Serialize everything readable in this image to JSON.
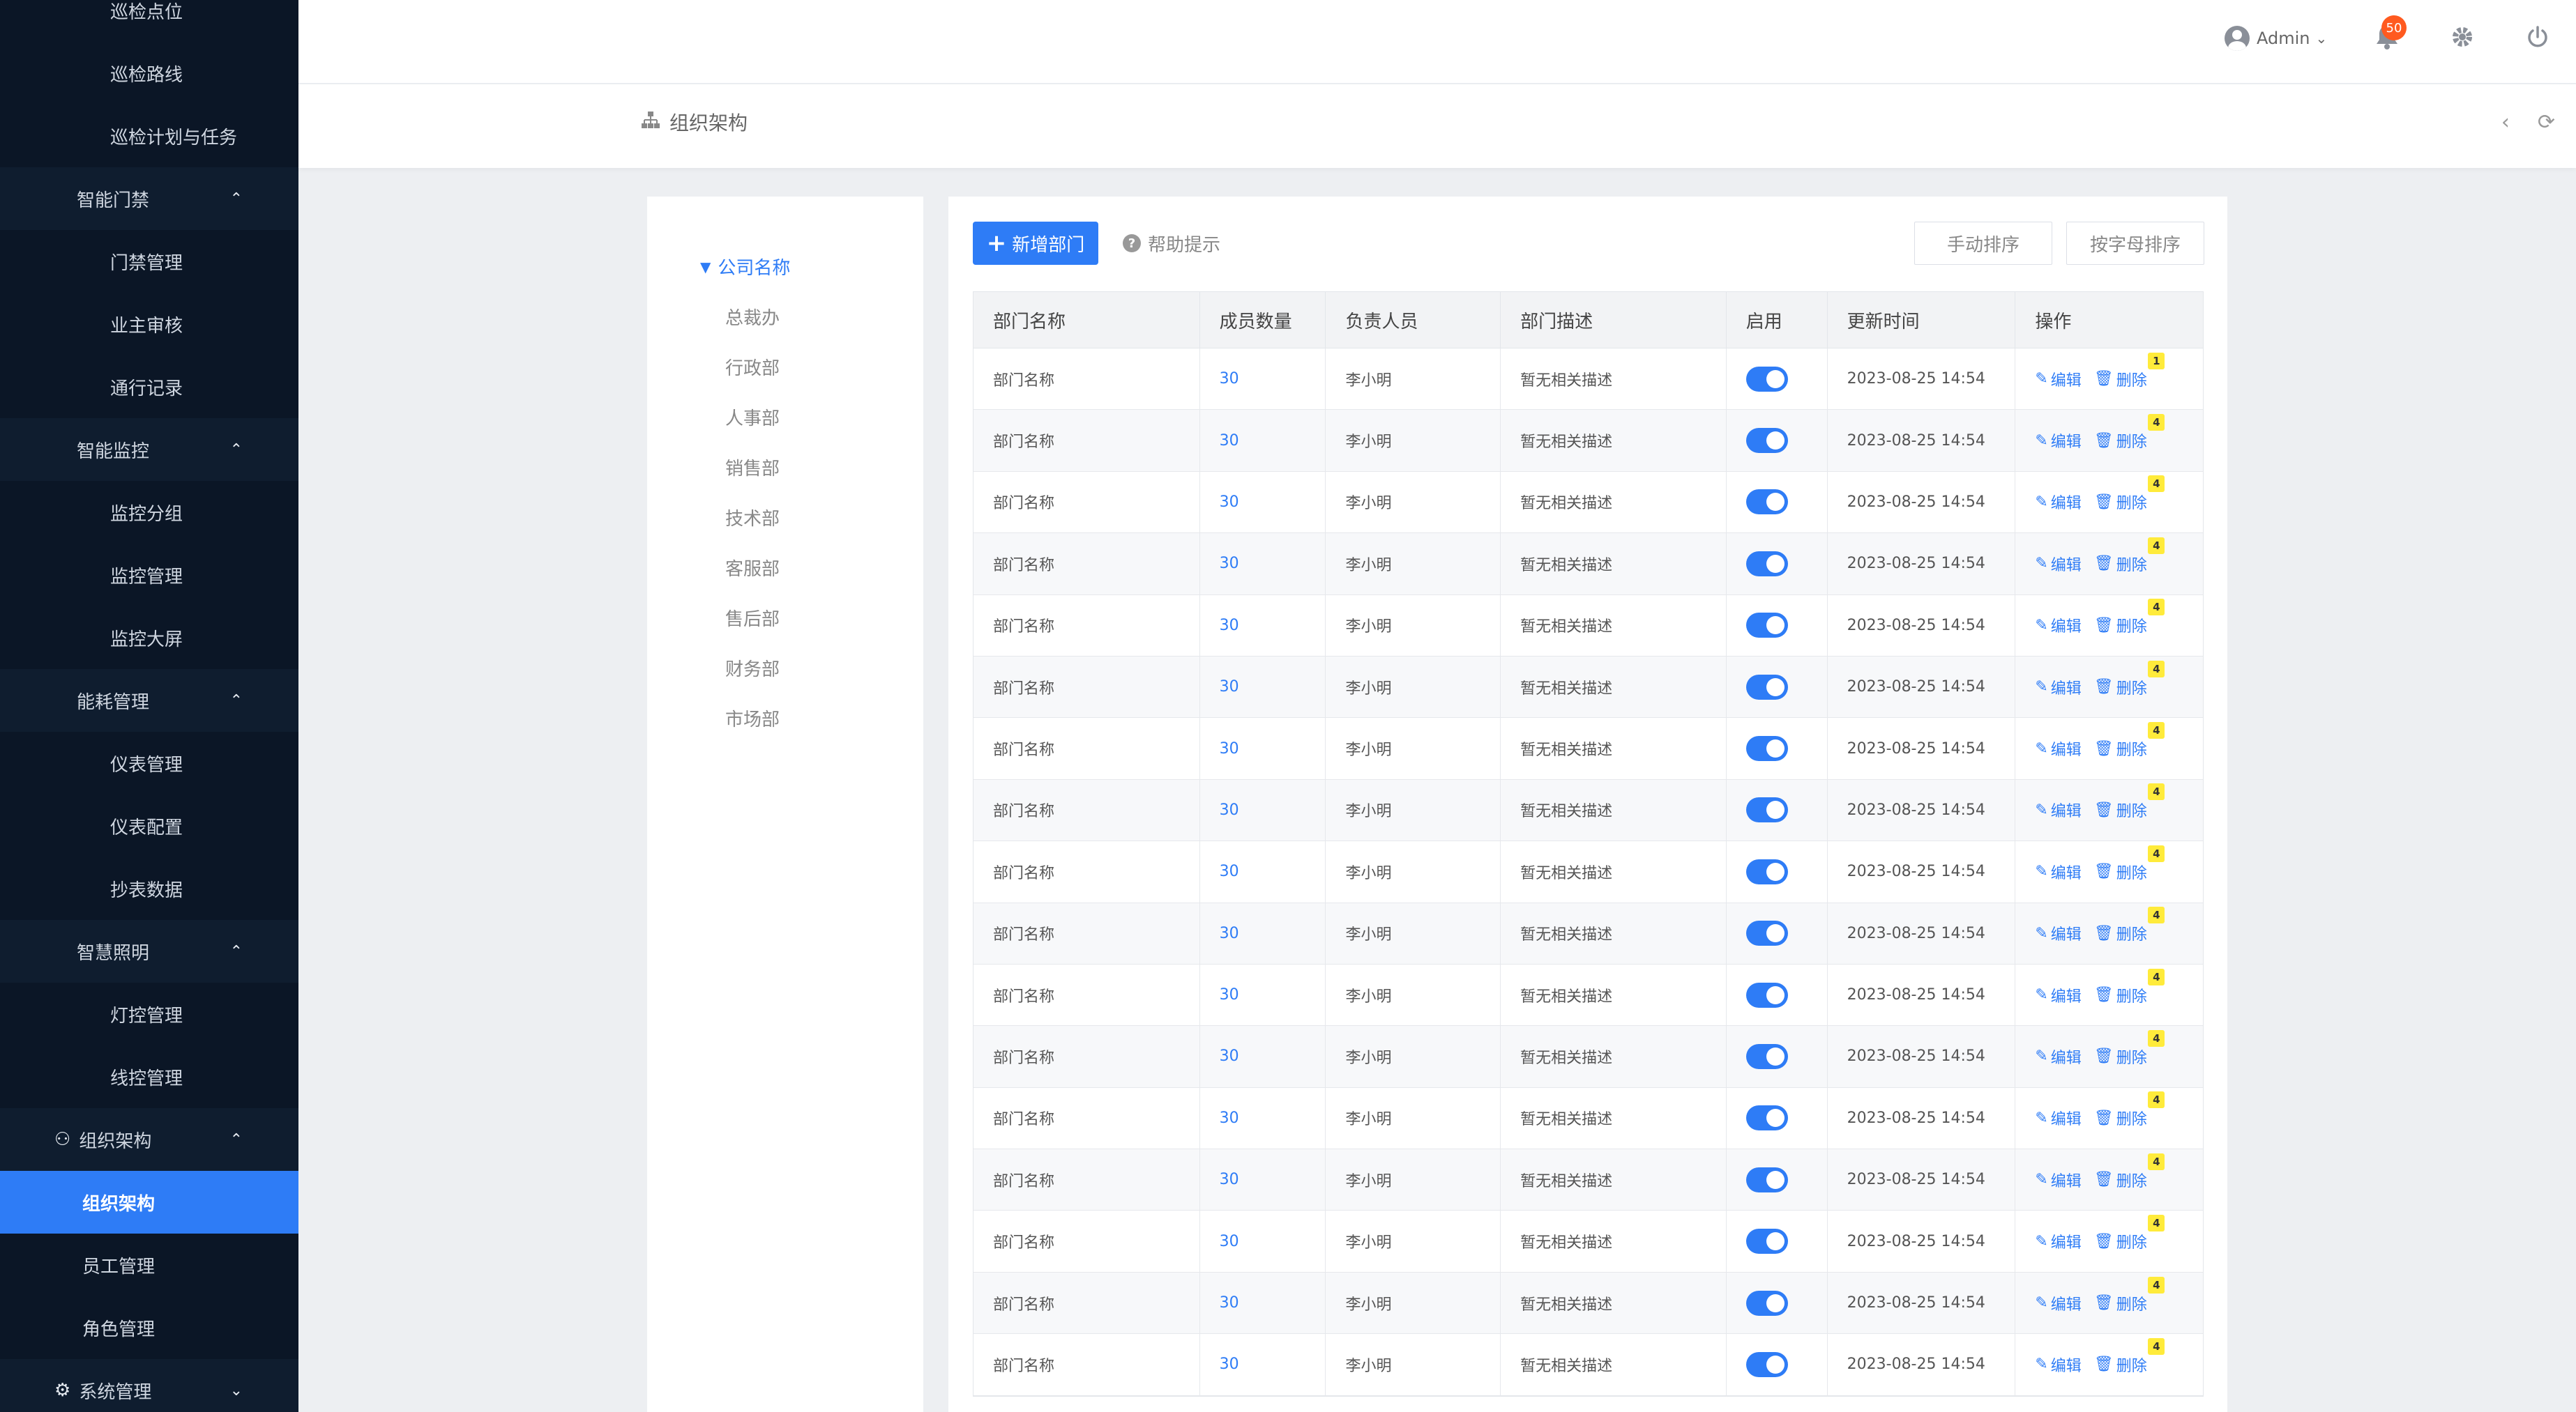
{
  "sidebar": {
    "items": [
      {
        "type": "sub",
        "label": "巡检点位"
      },
      {
        "type": "sub",
        "label": "巡检路线"
      },
      {
        "type": "sub",
        "label": "巡检计划与任务"
      },
      {
        "type": "group",
        "label": "智能门禁"
      },
      {
        "type": "sub",
        "label": "门禁管理"
      },
      {
        "type": "sub",
        "label": "业主审核"
      },
      {
        "type": "sub",
        "label": "通行记录"
      },
      {
        "type": "group",
        "label": "智能监控"
      },
      {
        "type": "sub",
        "label": "监控分组"
      },
      {
        "type": "sub",
        "label": "监控管理"
      },
      {
        "type": "sub",
        "label": "监控大屏"
      },
      {
        "type": "group",
        "label": "能耗管理"
      },
      {
        "type": "sub",
        "label": "仪表管理"
      },
      {
        "type": "sub",
        "label": "仪表配置"
      },
      {
        "type": "sub",
        "label": "抄表数据"
      },
      {
        "type": "group",
        "label": "智慧照明"
      },
      {
        "type": "sub",
        "label": "灯控管理"
      },
      {
        "type": "sub",
        "label": "线控管理"
      },
      {
        "type": "group-icon",
        "label": "组织架构",
        "icon": "users-icon"
      },
      {
        "type": "active",
        "label": "组织架构"
      },
      {
        "type": "sub2",
        "label": "员工管理"
      },
      {
        "type": "sub2",
        "label": "角色管理"
      },
      {
        "type": "group-icon-down",
        "label": "系统管理",
        "icon": "gear-icon"
      }
    ]
  },
  "header": {
    "user": "Admin",
    "notification_count": "50"
  },
  "breadcrumb": {
    "title": "组织架构"
  },
  "tree": {
    "root": "公司名称",
    "nodes": [
      "总裁办",
      "行政部",
      "人事部",
      "销售部",
      "技术部",
      "客服部",
      "售后部",
      "财务部",
      "市场部"
    ]
  },
  "toolbar": {
    "add_label": "新增部门",
    "help_label": "帮助提示",
    "manual_sort": "手动排序",
    "alpha_sort": "按字母排序"
  },
  "table": {
    "columns": [
      "部门名称",
      "成员数量",
      "负责人员",
      "部门描述",
      "启用",
      "更新时间",
      "操作"
    ],
    "edit_label": "编辑",
    "delete_label": "删除",
    "rows": [
      {
        "name": "部门名称",
        "count": "30",
        "owner": "李小明",
        "desc": "暂无相关描述",
        "enabled": true,
        "updated": "2023-08-25 14:54",
        "tag": "1"
      },
      {
        "name": "部门名称",
        "count": "30",
        "owner": "李小明",
        "desc": "暂无相关描述",
        "enabled": true,
        "updated": "2023-08-25 14:54",
        "tag": "4"
      },
      {
        "name": "部门名称",
        "count": "30",
        "owner": "李小明",
        "desc": "暂无相关描述",
        "enabled": true,
        "updated": "2023-08-25 14:54",
        "tag": "4"
      },
      {
        "name": "部门名称",
        "count": "30",
        "owner": "李小明",
        "desc": "暂无相关描述",
        "enabled": true,
        "updated": "2023-08-25 14:54",
        "tag": "4"
      },
      {
        "name": "部门名称",
        "count": "30",
        "owner": "李小明",
        "desc": "暂无相关描述",
        "enabled": true,
        "updated": "2023-08-25 14:54",
        "tag": "4"
      },
      {
        "name": "部门名称",
        "count": "30",
        "owner": "李小明",
        "desc": "暂无相关描述",
        "enabled": true,
        "updated": "2023-08-25 14:54",
        "tag": "4"
      },
      {
        "name": "部门名称",
        "count": "30",
        "owner": "李小明",
        "desc": "暂无相关描述",
        "enabled": true,
        "updated": "2023-08-25 14:54",
        "tag": "4"
      },
      {
        "name": "部门名称",
        "count": "30",
        "owner": "李小明",
        "desc": "暂无相关描述",
        "enabled": true,
        "updated": "2023-08-25 14:54",
        "tag": "4"
      },
      {
        "name": "部门名称",
        "count": "30",
        "owner": "李小明",
        "desc": "暂无相关描述",
        "enabled": true,
        "updated": "2023-08-25 14:54",
        "tag": "4"
      },
      {
        "name": "部门名称",
        "count": "30",
        "owner": "李小明",
        "desc": "暂无相关描述",
        "enabled": true,
        "updated": "2023-08-25 14:54",
        "tag": "4"
      },
      {
        "name": "部门名称",
        "count": "30",
        "owner": "李小明",
        "desc": "暂无相关描述",
        "enabled": true,
        "updated": "2023-08-25 14:54",
        "tag": "4"
      },
      {
        "name": "部门名称",
        "count": "30",
        "owner": "李小明",
        "desc": "暂无相关描述",
        "enabled": true,
        "updated": "2023-08-25 14:54",
        "tag": "4"
      },
      {
        "name": "部门名称",
        "count": "30",
        "owner": "李小明",
        "desc": "暂无相关描述",
        "enabled": true,
        "updated": "2023-08-25 14:54",
        "tag": "4"
      },
      {
        "name": "部门名称",
        "count": "30",
        "owner": "李小明",
        "desc": "暂无相关描述",
        "enabled": true,
        "updated": "2023-08-25 14:54",
        "tag": "4"
      },
      {
        "name": "部门名称",
        "count": "30",
        "owner": "李小明",
        "desc": "暂无相关描述",
        "enabled": true,
        "updated": "2023-08-25 14:54",
        "tag": "4"
      },
      {
        "name": "部门名称",
        "count": "30",
        "owner": "李小明",
        "desc": "暂无相关描述",
        "enabled": true,
        "updated": "2023-08-25 14:54",
        "tag": "4"
      },
      {
        "name": "部门名称",
        "count": "30",
        "owner": "李小明",
        "desc": "暂无相关描述",
        "enabled": true,
        "updated": "2023-08-25 14:54",
        "tag": "4"
      }
    ]
  },
  "colors": {
    "accent": "#2e7cf6",
    "sidebar_bg": "#0b1626",
    "badge": "#ff5a1f",
    "tag_bg": "#ffeb3b"
  }
}
